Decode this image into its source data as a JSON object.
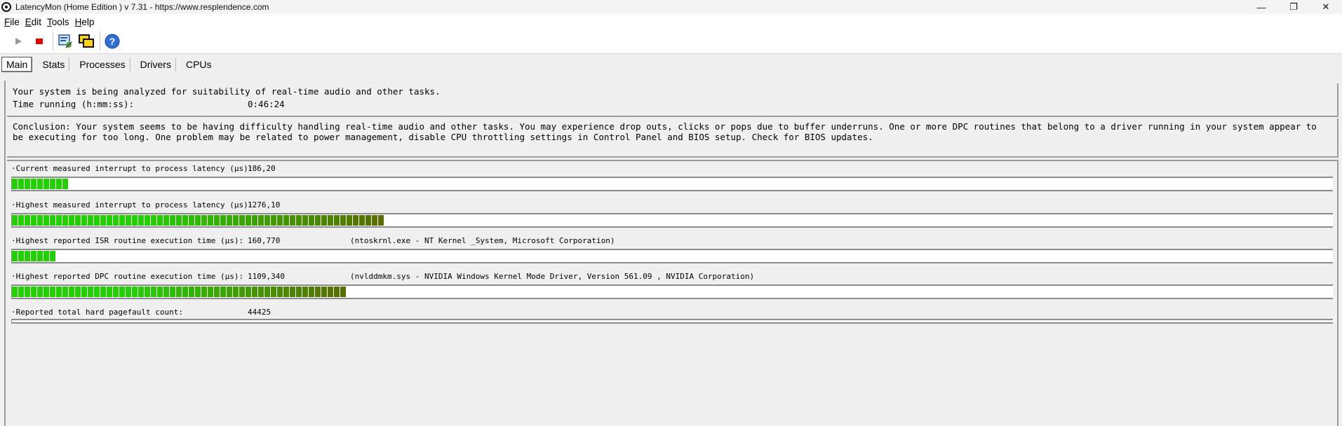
{
  "window": {
    "title": "LatencyMon  (Home Edition )  v 7.31 - https://www.resplendence.com",
    "minimize": "—",
    "maximize": "❐",
    "close": "✕"
  },
  "menu": [
    "File",
    "Edit",
    "Tools",
    "Help"
  ],
  "toolbar": {
    "buttons": [
      "play-icon",
      "stop-icon",
      "report-icon",
      "windows-icon",
      "help-icon"
    ]
  },
  "tabs": [
    {
      "label": "Main",
      "active": true
    },
    {
      "label": "Stats",
      "active": false
    },
    {
      "label": "Processes",
      "active": false
    },
    {
      "label": "Drivers",
      "active": false
    },
    {
      "label": "CPUs",
      "active": false
    }
  ],
  "status": {
    "line1": "Your system is being analyzed for suitability of real-time audio and other tasks.",
    "time_label": "Time running (h:mm:ss):",
    "time_value": "0:46:24"
  },
  "conclusion": "Conclusion: Your system seems to be having difficulty handling real-time audio and other tasks. You may experience drop outs, clicks or pops due to buffer underruns. One or more DPC routines that belong to a driver running in your system appear to be executing for too long. One problem may be related to power management, disable CPU throttling settings in Control Panel and BIOS setup. Check for BIOS updates.",
  "metrics": [
    {
      "label": "·Current measured interrupt to process latency (µs):",
      "value": "186,20",
      "extra": "",
      "fill_fraction": 0.054,
      "segments": 9
    },
    {
      "label": "·Highest measured interrupt to process latency (µs):",
      "value": "1276,10",
      "extra": "",
      "fill_fraction": 0.344,
      "segments": 59
    },
    {
      "label": "·Highest reported ISR routine execution time (µs):",
      "value": "160,770",
      "extra": "(ntoskrnl.exe - NT Kernel _System, Microsoft Corporation)",
      "fill_fraction": 0.043,
      "segments": 7
    },
    {
      "label": "·Highest reported DPC routine execution time (µs):",
      "value": "1109,340",
      "extra": "(nvlddmkm.sys - NVIDIA Windows Kernel Mode Driver, Version 561.09 , NVIDIA Corporation)",
      "fill_fraction": 0.312,
      "segments": 53
    },
    {
      "label": "·Reported total hard pagefault count:",
      "value": "44425",
      "extra": "",
      "fill_fraction": 0,
      "segments": 0
    }
  ],
  "colors": {
    "meter_green": "#22d000",
    "meter_olive": "#5a6b00",
    "border": "#9a9a9a"
  }
}
